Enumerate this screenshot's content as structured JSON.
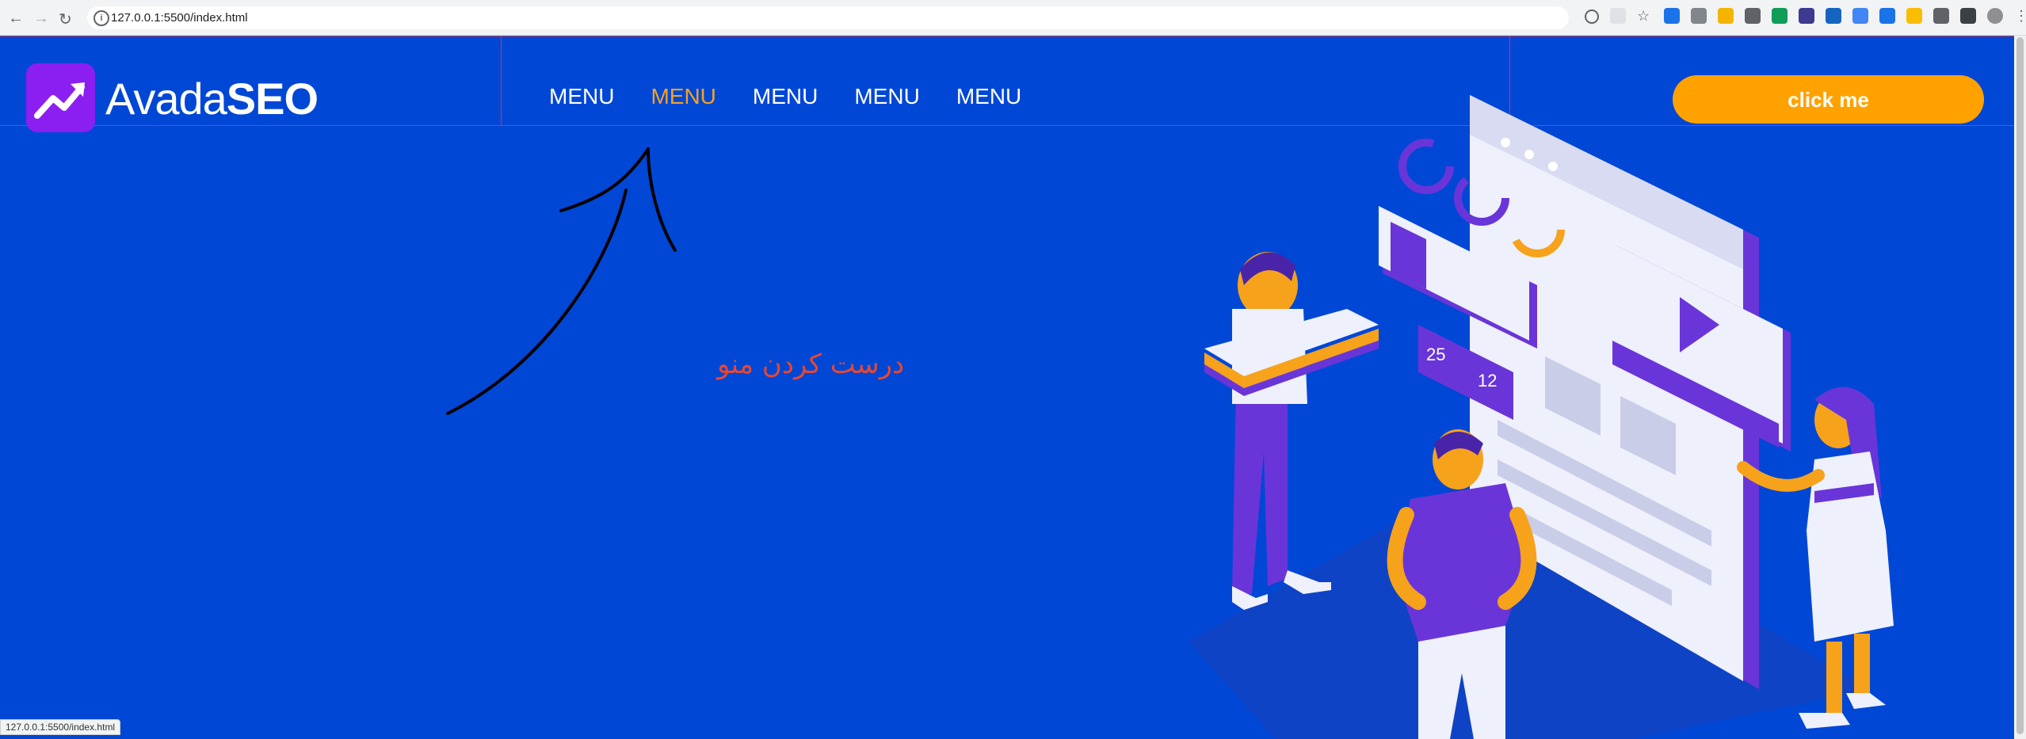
{
  "browser": {
    "url": "127.0.0.1:5500/index.html",
    "status_url": "127.0.0.1:5500/index.html"
  },
  "brand": {
    "name_light": "Avada",
    "name_bold": "SEO"
  },
  "menu": {
    "items": [
      {
        "label": "MENU",
        "active": false
      },
      {
        "label": "MENU",
        "active": true
      },
      {
        "label": "MENU",
        "active": false
      },
      {
        "label": "MENU",
        "active": false
      },
      {
        "label": "MENU",
        "active": false
      }
    ]
  },
  "cta": {
    "label": "click me"
  },
  "annotation": {
    "text": "درست کردن منو"
  },
  "illustration": {
    "likes": "25",
    "comments": "12"
  },
  "colors": {
    "background": "#0047d6",
    "accent": "#ffa200",
    "active_menu": "#f7a21b",
    "logo_bg": "#8b1ff2",
    "annotation": "#e8472f"
  }
}
